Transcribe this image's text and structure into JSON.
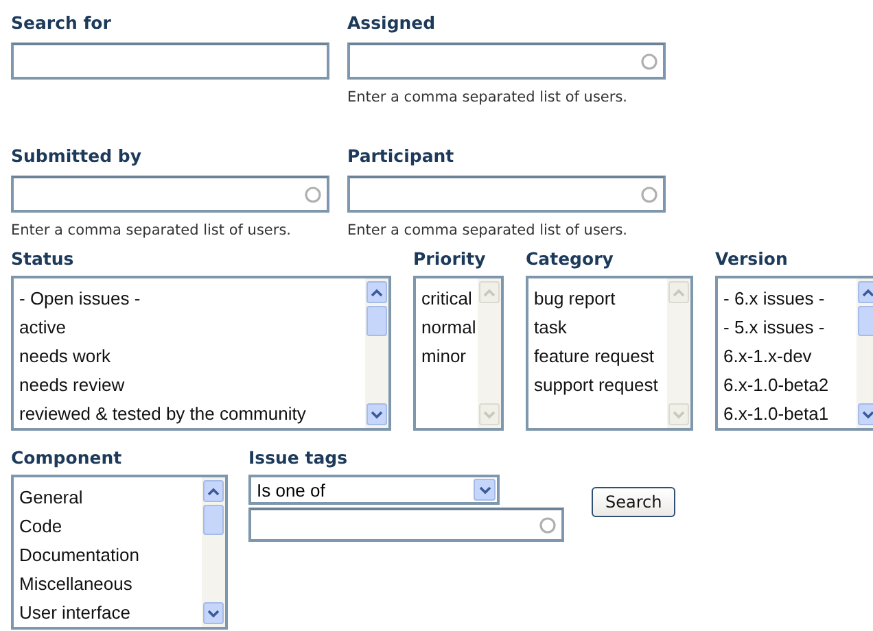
{
  "fields": [
    {
      "label": "Search for",
      "autocomplete": false
    },
    {
      "label": "Assigned",
      "autocomplete": true,
      "help": "Enter a comma separated list of users."
    },
    {
      "label": "Submitted by",
      "autocomplete": true,
      "help": "Enter a comma separated list of users."
    },
    {
      "label": "Participant",
      "autocomplete": true,
      "help": "Enter a comma separated list of users."
    }
  ],
  "lists": [
    {
      "label": "Status",
      "kind": "wide",
      "scrollable": true,
      "options": [
        "- Open issues -",
        "active",
        "needs work",
        "needs review",
        "reviewed & tested by the community"
      ]
    },
    {
      "label": "Priority",
      "kind": "narrow",
      "scrollable": false,
      "options": [
        "critical",
        "normal",
        "minor"
      ]
    },
    {
      "label": "Category",
      "kind": "medium",
      "scrollable": false,
      "options": [
        "bug report",
        "task",
        "feature request",
        "support request"
      ]
    },
    {
      "label": "Version",
      "kind": "medium",
      "scrollable": true,
      "options": [
        "- 6.x issues -",
        "- 5.x issues -",
        "6.x-1.x-dev",
        "6.x-1.0-beta2",
        "6.x-1.0-beta1"
      ]
    }
  ],
  "component": {
    "label": "Component",
    "scrollable": true,
    "options": [
      "General",
      "Code",
      "Documentation",
      "Miscellaneous",
      "User interface"
    ]
  },
  "issue_tags": {
    "label": "Issue tags",
    "operator": "Is one of",
    "autocomplete": true
  },
  "search_button": "Search"
}
